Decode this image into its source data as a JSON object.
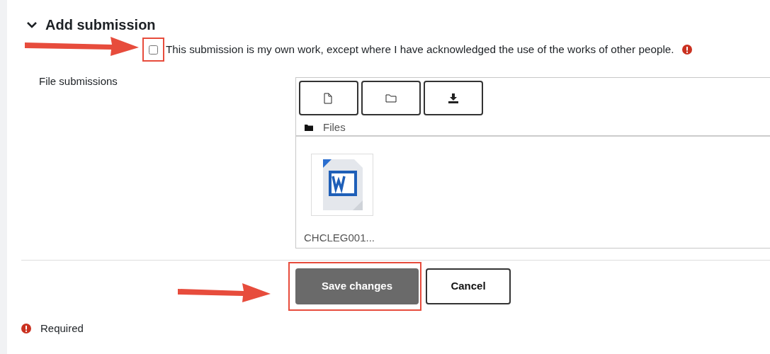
{
  "section": {
    "title": "Add submission",
    "expanded": true
  },
  "acknowledgement": {
    "text": "This submission is my own work, except where I have acknowledged the use of the works of other people.",
    "checked": false,
    "required": true
  },
  "file_submissions": {
    "label": "File submissions",
    "toolbar": [
      {
        "kind": "file"
      },
      {
        "kind": "folder"
      },
      {
        "kind": "download"
      }
    ],
    "path": "Files",
    "files": [
      {
        "name": "CHCLEG001...",
        "kind": "word"
      }
    ]
  },
  "buttons": [
    {
      "label": "Save changes",
      "kind": "primary"
    },
    {
      "label": "Cancel",
      "kind": "secondary"
    }
  ],
  "required_note": "Required"
}
